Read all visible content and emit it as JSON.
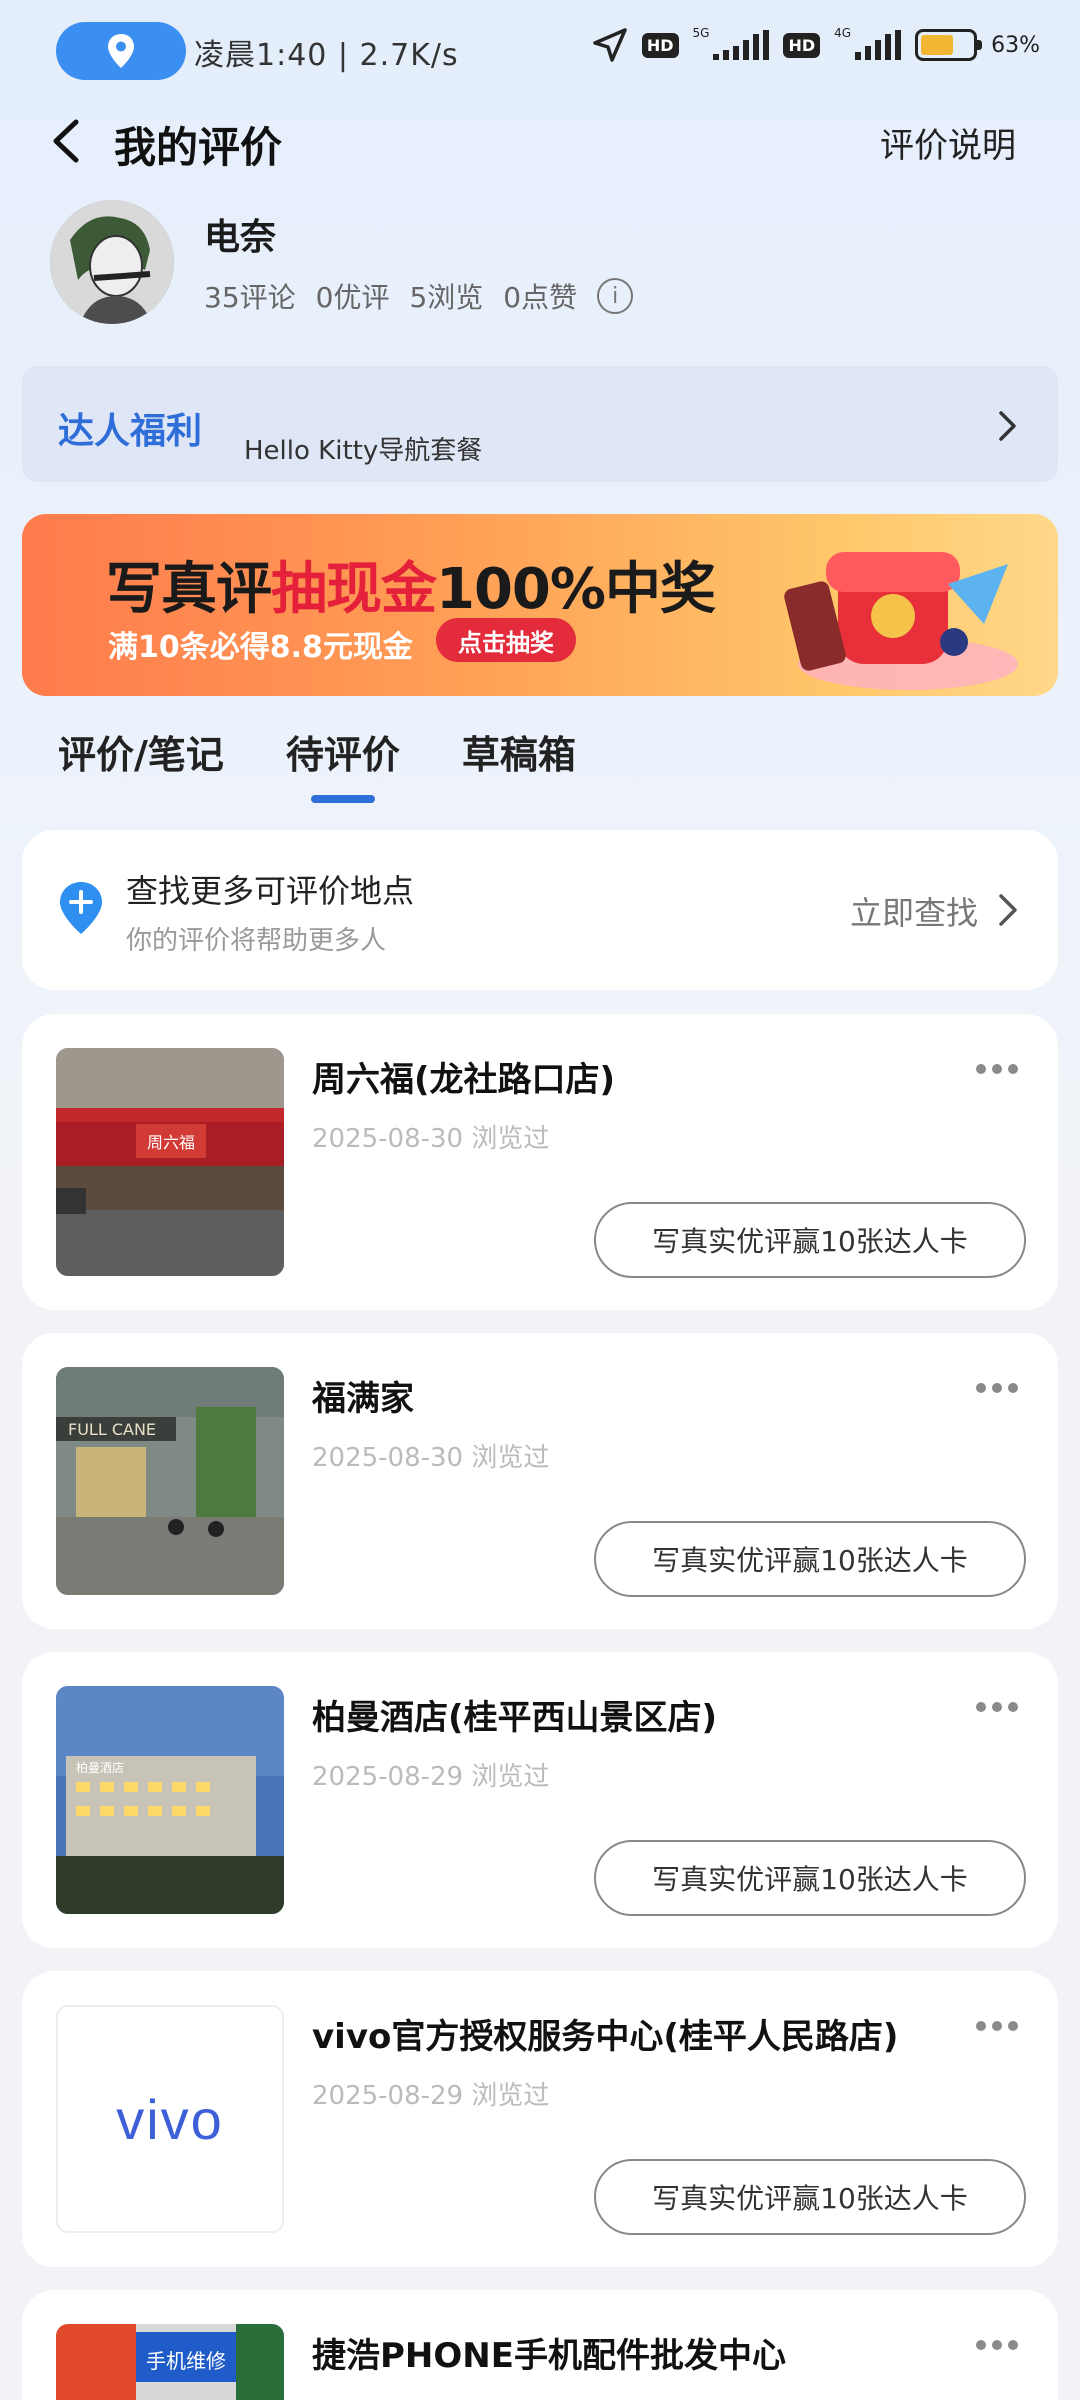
{
  "status_bar": {
    "time_speed": "凌晨1:40 | 2.7K/s",
    "net_5g": "5G",
    "net_4g": "4G",
    "hd": "HD",
    "battery_percent": "63%",
    "battery_level": 0.63
  },
  "header": {
    "title": "我的评价",
    "help_link": "评价说明"
  },
  "profile": {
    "username": "电奈",
    "reviews": "35评论",
    "good_reviews": "0优评",
    "views": "5浏览",
    "likes": "0点赞"
  },
  "benefit": {
    "title": "达人福利",
    "subtitle": "Hello Kitty导航套餐"
  },
  "banner": {
    "head_part1": "写真评",
    "head_part2": "抽现金",
    "head_part3": "100%中奖",
    "sub": "满10条必得8.8元现金",
    "button": "点击抽奖"
  },
  "tabs": [
    {
      "label": "评价/笔记"
    },
    {
      "label": "待评价"
    },
    {
      "label": "草稿箱"
    }
  ],
  "find": {
    "title": "查找更多可评价地点",
    "subtitle": "你的评价将帮助更多人",
    "action": "立即查找"
  },
  "reviews": [
    {
      "title": "周六福(龙社路口店)",
      "date": "2025-08-30 浏览过",
      "button": "写真实优评赢10张达人卡",
      "thumb_text": "周六福"
    },
    {
      "title": "福满家",
      "date": "2025-08-30 浏览过",
      "button": "写真实优评赢10张达人卡",
      "thumb_text": "FULL CANE"
    },
    {
      "title": "柏曼酒店(桂平西山景区店)",
      "date": "2025-08-29 浏览过",
      "button": "写真实优评赢10张达人卡",
      "thumb_text": "柏曼酒店"
    },
    {
      "title": "vivo官方授权服务中心(桂平人民路店)",
      "date": "2025-08-29 浏览过",
      "button": "写真实优评赢10张达人卡",
      "thumb_text": "vivo"
    },
    {
      "title": "捷浩PHONE手机配件批发中心",
      "date": "",
      "button": "",
      "thumb_text": "手机维修"
    }
  ],
  "colors": {
    "accent": "#2f6ed8",
    "pill": "#3a8ff0",
    "banner_red": "#e4203a"
  }
}
